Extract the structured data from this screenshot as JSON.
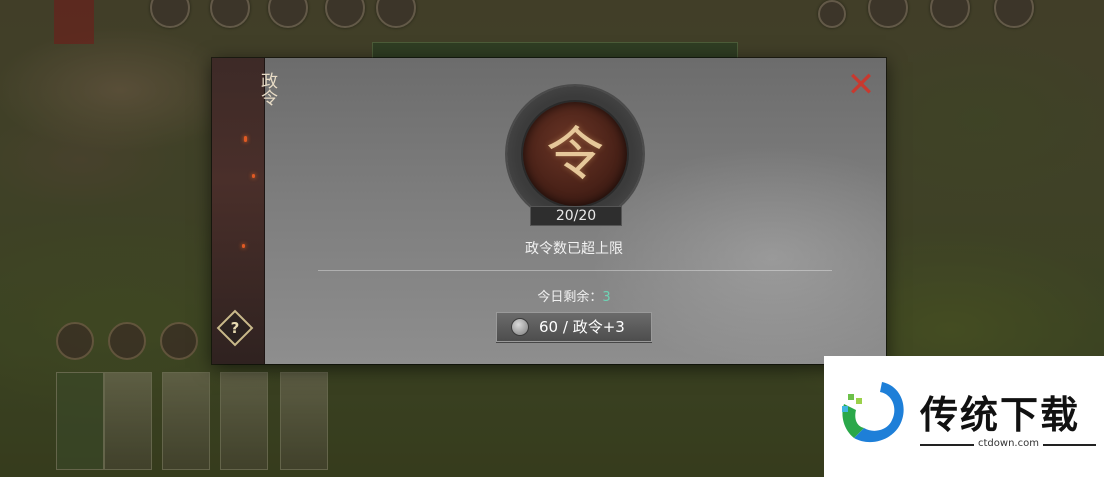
{
  "dialog": {
    "side_title": "政令",
    "emblem_char": "令",
    "count": "20/20",
    "status": "政令数已超上限",
    "remaining_label": "今日剩余：",
    "remaining_value": "3",
    "buy": {
      "price": "60",
      "sep": " / ",
      "reward": "政令+3"
    },
    "close_icon": "close-icon",
    "help_label": "?"
  },
  "watermark": {
    "title": "传统下载",
    "url": "ctdown.com"
  }
}
